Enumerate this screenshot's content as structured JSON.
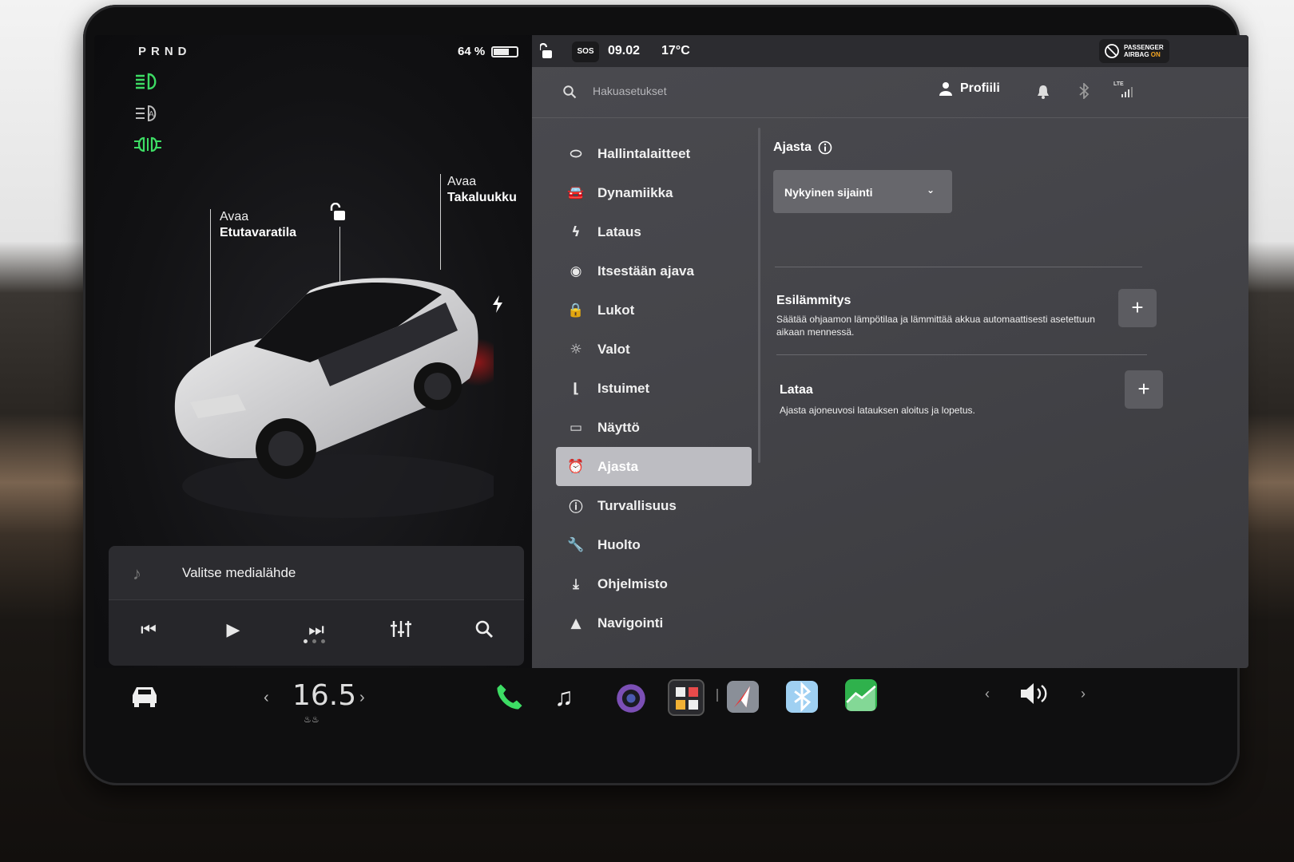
{
  "car_panel": {
    "gear": "PRND",
    "battery_percent": "64 %",
    "battery_level": 0.64,
    "frunk_label_1": "Avaa",
    "frunk_label_2": "Etutavaratila",
    "trunk_label_1": "Avaa",
    "trunk_label_2": "Takaluukku"
  },
  "status_bar": {
    "sos": "SOS",
    "time": "09.02",
    "temp": "17°C",
    "airbag_1": "PASSENGER",
    "airbag_2": "AIRBAG",
    "airbag_3": "ON"
  },
  "search": {
    "placeholder": "Hakuasetukset"
  },
  "profile": {
    "label": "Profiili",
    "lte": "LTE"
  },
  "menu": {
    "items": [
      {
        "label": "Hallintalaitteet",
        "icon": "toggle-icon"
      },
      {
        "label": "Dynamiikka",
        "icon": "car-icon"
      },
      {
        "label": "Lataus",
        "icon": "bolt-icon"
      },
      {
        "label": "Itsestään ajava",
        "icon": "steering-wheel-icon"
      },
      {
        "label": "Lukot",
        "icon": "lock-icon"
      },
      {
        "label": "Valot",
        "icon": "light-icon"
      },
      {
        "label": "Istuimet",
        "icon": "seat-icon"
      },
      {
        "label": "Näyttö",
        "icon": "display-icon"
      },
      {
        "label": "Ajasta",
        "icon": "alarm-clock-icon"
      },
      {
        "label": "Turvallisuus",
        "icon": "alert-icon"
      },
      {
        "label": "Huolto",
        "icon": "wrench-icon"
      },
      {
        "label": "Ohjelmisto",
        "icon": "download-icon"
      },
      {
        "label": "Navigointi",
        "icon": "navigation-icon"
      }
    ]
  },
  "content": {
    "title": "Ajasta",
    "dropdown": "Nykyinen sijainti",
    "precondition": {
      "title": "Esilämmitys",
      "desc": "Säätää ohjaamon lämpötilaa ja lämmittää akkua automaattisesti asetettuun aikaan mennessä."
    },
    "charge": {
      "title": "Lataa",
      "desc": "Ajasta ajoneuvosi latauksen aloitus ja lopetus."
    }
  },
  "media": {
    "source": "Valitse medialähde"
  },
  "dock": {
    "temperature": "16.5",
    "apps": [
      "phone-icon",
      "music-icon",
      "camera-icon",
      "app-launcher-icon",
      "navigation-app-icon",
      "bluetooth-icon",
      "energy-app-icon"
    ]
  },
  "colors": {
    "accent_green": "#3ddc64",
    "selected_bg": "#bdbdc2",
    "panel_bg": "#45454a"
  }
}
